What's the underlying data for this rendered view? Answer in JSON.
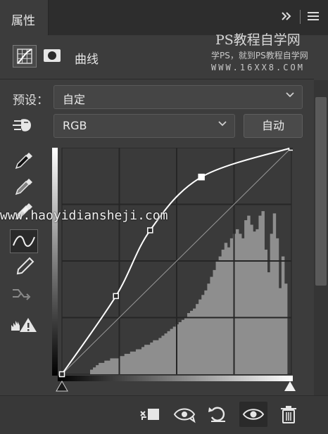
{
  "panel": {
    "tab_label": "属性",
    "expand_icon": "double-chevron-right-icon",
    "menu_icon": "hamburger-menu-icon"
  },
  "watermark": {
    "site_title": "PS教程自学网",
    "tagline": "学PS，就到PS教程自学网",
    "domain": "WWW.16XX8.COM",
    "overlay_url": "www.haoyidiansheji.com"
  },
  "header": {
    "title": "曲线"
  },
  "preset": {
    "label": "预设：",
    "value": "自定"
  },
  "channel": {
    "value": "RGB",
    "auto_button": "自动"
  },
  "tools": [
    "hand-target-icon",
    "eyedropper-black-icon",
    "eyedropper-gray-icon",
    "eyedropper-white-icon",
    "curve-point-icon",
    "pencil-icon",
    "smooth-icon",
    "clipping-warning-icon"
  ],
  "curve": {
    "input_range": [
      0,
      255
    ],
    "output_range": [
      0,
      255
    ],
    "points": [
      [
        0,
        0
      ],
      [
        60,
        88
      ],
      [
        98,
        162
      ],
      [
        155,
        222
      ],
      [
        255,
        255
      ]
    ],
    "selected_point_index": 3,
    "histogram": [
      0.02,
      0.03,
      0.04,
      0.05,
      0.05,
      0.06,
      0.06,
      0.07,
      0.07,
      0.07,
      0.08,
      0.08,
      0.09,
      0.09,
      0.1,
      0.1,
      0.11,
      0.11,
      0.12,
      0.13,
      0.13,
      0.14,
      0.15,
      0.15,
      0.16,
      0.17,
      0.18,
      0.19,
      0.2,
      0.21,
      0.22,
      0.23,
      0.24,
      0.25,
      0.27,
      0.28,
      0.29,
      0.31,
      0.33,
      0.35,
      0.37,
      0.4,
      0.43,
      0.46,
      0.5,
      0.52,
      0.55,
      0.58,
      0.56,
      0.6,
      0.62,
      0.64,
      0.62,
      0.6,
      0.68,
      0.7,
      0.66,
      0.63,
      0.64,
      0.7,
      0.72,
      0.55,
      0.45,
      0.62,
      0.71,
      0.6,
      0.38,
      0.52,
      0.4
    ]
  },
  "bottom_bar": {
    "icons": [
      "clip-to-layer-icon",
      "view-previous-state-icon",
      "reset-icon",
      "visibility-eye-icon",
      "trash-icon"
    ]
  }
}
